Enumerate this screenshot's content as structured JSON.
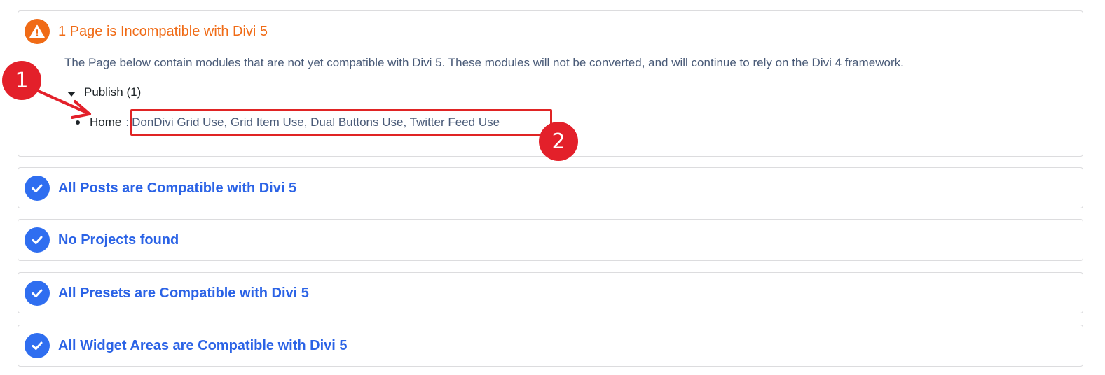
{
  "incompatible": {
    "title": "1 Page is Incompatible with Divi 5",
    "description": "The Page below contain modules that are not yet compatible with Divi 5. These modules will not be converted, and will continue to rely on the Divi 4 framework.",
    "status_group": "Publish (1)",
    "pages": [
      {
        "link": "Home",
        "separator": ":",
        "modules": "DonDivi Grid Use, Grid Item Use, Dual Buttons Use, Twitter Feed Use"
      }
    ]
  },
  "compatible_sections": [
    {
      "title": "All Posts are Compatible with Divi 5"
    },
    {
      "title": "No Projects found"
    },
    {
      "title": "All Presets are Compatible with Divi 5"
    },
    {
      "title": "All Widget Areas are Compatible with Divi 5"
    }
  ],
  "annotations": {
    "marker_1": "1",
    "marker_2": "2"
  },
  "colors": {
    "warning": "#f06b16",
    "success": "#2b63e6",
    "annotation": "#e3202a"
  },
  "icons": {
    "warning": "warning-triangle-icon",
    "success": "check-circle-icon"
  }
}
